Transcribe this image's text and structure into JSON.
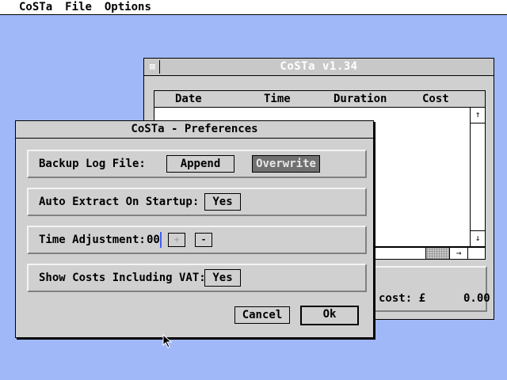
{
  "menubar": {
    "items": [
      "CoSTa",
      "File",
      "Options"
    ]
  },
  "main_window": {
    "title": "CoSTa v1.34",
    "columns": [
      "Date",
      "Time",
      "Duration",
      "Cost"
    ],
    "scroll_up_symbol": "↑",
    "scroll_down_symbol": "↓",
    "scroll_right_symbol": "→",
    "total_cost_label": "cost: £",
    "total_cost_value": "0.00"
  },
  "preferences_dialog": {
    "title": "CoSTa - Preferences",
    "backup_log": {
      "label": "Backup Log File:",
      "options": [
        "Append",
        "Overwrite"
      ],
      "selected": "Overwrite"
    },
    "auto_extract": {
      "label": "Auto Extract On Startup:",
      "value": "Yes"
    },
    "time_adjustment": {
      "label": "Time Adjustment:",
      "value": "00",
      "increment_label": "+",
      "decrement_label": "-"
    },
    "show_costs_vat": {
      "label": "Show Costs Including VAT:",
      "value": "Yes"
    },
    "cancel_label": "Cancel",
    "ok_label": "Ok"
  },
  "colors": {
    "desktop": "#a0b8f8",
    "window_gray": "#d0d0d0",
    "selected_button": "#707070"
  }
}
